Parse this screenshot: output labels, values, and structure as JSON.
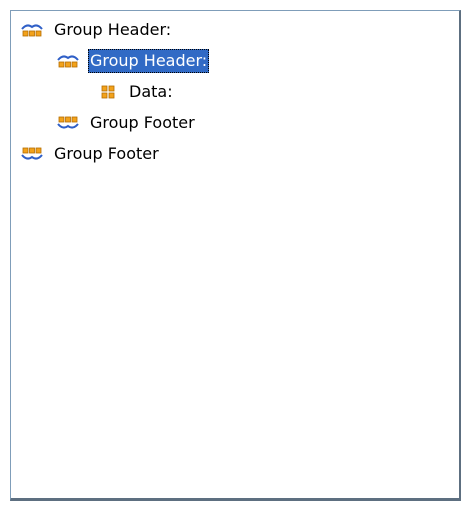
{
  "tree": {
    "nodes": [
      {
        "label": "Group Header:",
        "icon": "group-header-icon",
        "selected": false
      },
      {
        "label": "Group Header:",
        "icon": "group-header-icon",
        "selected": true
      },
      {
        "label": "Data:",
        "icon": "data-icon",
        "selected": false
      },
      {
        "label": "Group Footer",
        "icon": "group-footer-icon",
        "selected": false
      },
      {
        "label": "Group Footer",
        "icon": "group-footer-icon",
        "selected": false
      }
    ]
  },
  "colors": {
    "selection": "#316ac5",
    "icon_blue": "#2f5fc7",
    "icon_orange": "#f2a21b",
    "panel_border": "#7f9db9"
  }
}
